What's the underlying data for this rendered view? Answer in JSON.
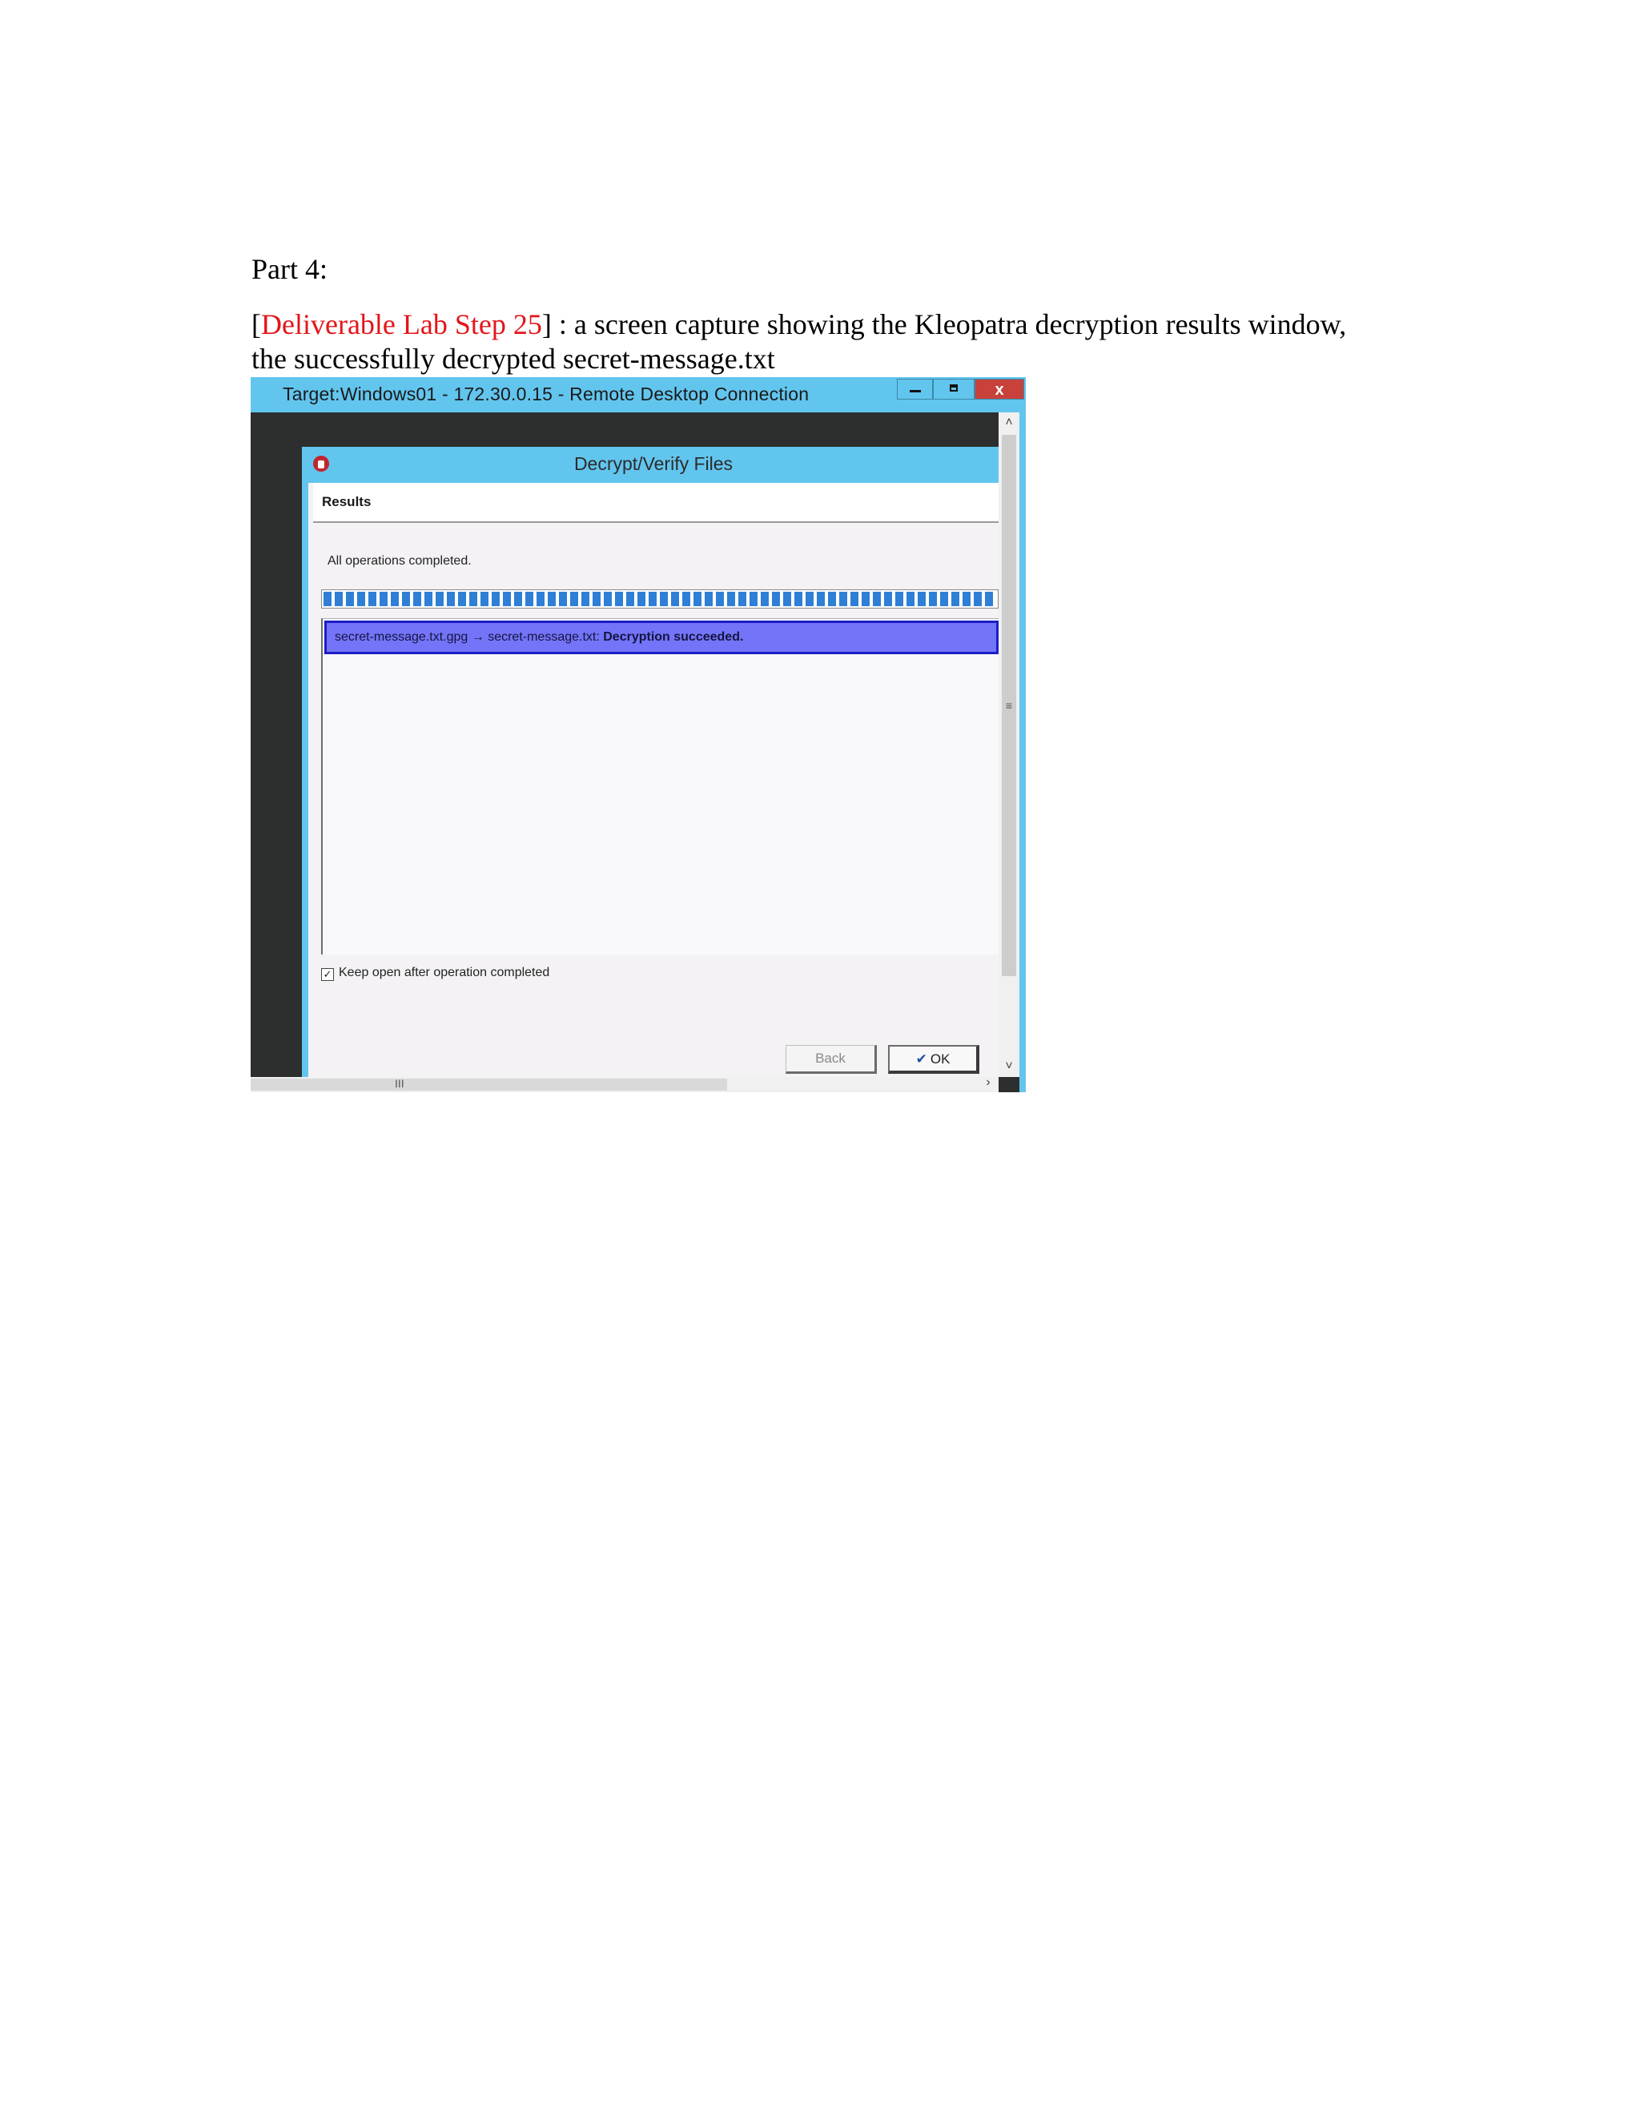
{
  "doc": {
    "heading": "Part 4:",
    "caption_bracket_open": "[",
    "caption_link": "Deliverable Lab Step 25",
    "caption_rest": "] : a screen capture showing the Kleopatra decryption results window, the successfully decrypted secret-message.txt"
  },
  "rdp": {
    "title": "Target:Windows01 - 172.30.0.15 - Remote Desktop Connection",
    "close_label": "x"
  },
  "dialog": {
    "title": "Decrypt/Verify Files",
    "section_title": "Results",
    "status": "All operations completed.",
    "progress": 1.0,
    "result_files": "secret-message.txt.gpg → secret-message.txt: ",
    "result_status": "Decryption succeeded.",
    "keep_open_label": "Keep open after operation completed",
    "keep_open_checked": true,
    "back_label": "Back",
    "ok_label": "OK"
  },
  "icons": {
    "check_glyph": "✔",
    "checkbox_glyph": "✓"
  }
}
